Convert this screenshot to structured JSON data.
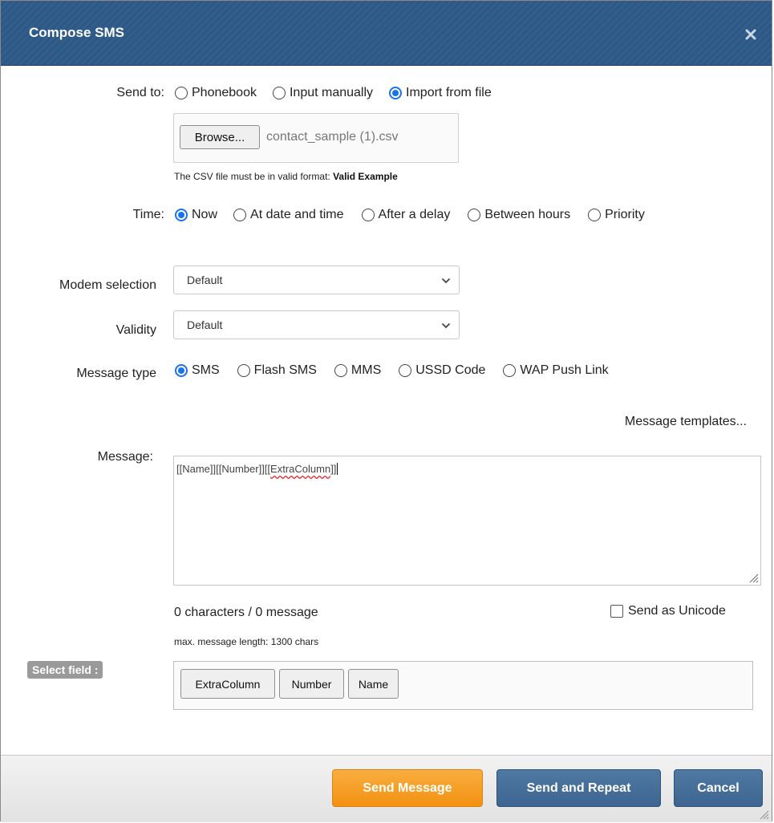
{
  "dialog": {
    "title": "Compose SMS"
  },
  "send_to": {
    "label": "Send to:",
    "options": [
      "Phonebook",
      "Input manually",
      "Import from file"
    ],
    "selected": "Import from file"
  },
  "file": {
    "browse_label": "Browse...",
    "filename": "contact_sample (1).csv",
    "note_prefix": "The CSV file must be in valid format: ",
    "note_link": "Valid Example"
  },
  "time": {
    "label": "Time:",
    "options": [
      "Now",
      "At date and time",
      "After a delay",
      "Between hours",
      "Priority"
    ],
    "selected": "Now"
  },
  "modem": {
    "label": "Modem selection",
    "value": "Default"
  },
  "validity": {
    "label": "Validity",
    "value": "Default"
  },
  "message_type": {
    "label": "Message type",
    "options": [
      "SMS",
      "Flash SMS",
      "MMS",
      "USSD Code",
      "WAP Push Link"
    ],
    "selected": "SMS"
  },
  "templates_link": "Message templates...",
  "message": {
    "label": "Message:",
    "text_part1": "[[Name]][[Number]][[",
    "text_misspelled": "ExtraColumn",
    "text_part2": "]]"
  },
  "counter": "0 characters / 0 message",
  "max_length": "max. message length: 1300 chars",
  "unicode_label": "Send as Unicode",
  "select_field": {
    "label": "Select field :",
    "fields": [
      "ExtraColumn",
      "Number",
      "Name"
    ]
  },
  "footer": {
    "send_label": "Send Message",
    "repeat_label": "Send and Repeat",
    "cancel_label": "Cancel"
  },
  "colors": {
    "title_bar": "#2d5987",
    "radio_selected": "#1a73e8",
    "send_button": "#f29112",
    "secondary_button": "#3d6590"
  },
  "icons": {
    "close": "close-icon",
    "dropdown": "chevron-down-icon",
    "resize": "resize-grip-icon"
  }
}
